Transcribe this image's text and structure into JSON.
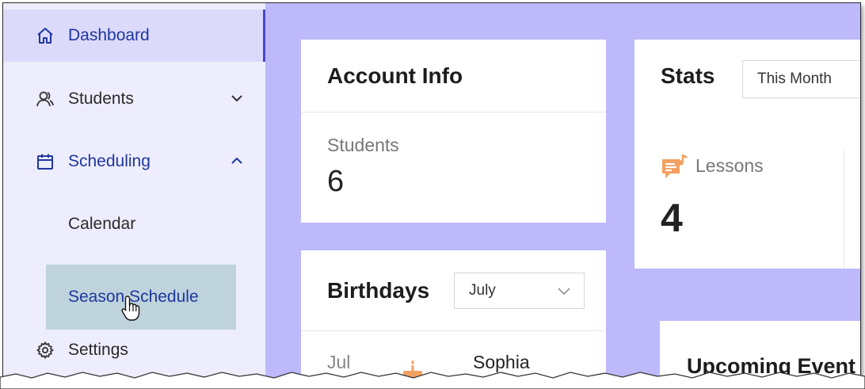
{
  "sidebar": {
    "items": [
      {
        "label": "Dashboard",
        "icon": "home-icon"
      },
      {
        "label": "Students",
        "icon": "users-icon"
      },
      {
        "label": "Scheduling",
        "icon": "calendar-icon"
      },
      {
        "label": "Calendar"
      },
      {
        "label": "Season Schedule"
      },
      {
        "label": "Settings",
        "icon": "gear-icon"
      }
    ]
  },
  "account_info": {
    "title": "Account Info",
    "students_label": "Students",
    "students_count": "6"
  },
  "stats": {
    "title": "Stats",
    "period_select": "This Month",
    "lessons_label": "Lessons",
    "lessons_count": "4"
  },
  "birthdays": {
    "title": "Birthdays",
    "month_select": "July",
    "entry_month": "Jul",
    "entry_name": "Sophia"
  },
  "events": {
    "title": "Upcoming Event"
  },
  "colors": {
    "background": "#bdb9fb",
    "sidebar": "#eeedfd",
    "accent": "#1e36a0",
    "hover_item": "#bfd3dc",
    "lessons_icon": "#f3a060"
  }
}
